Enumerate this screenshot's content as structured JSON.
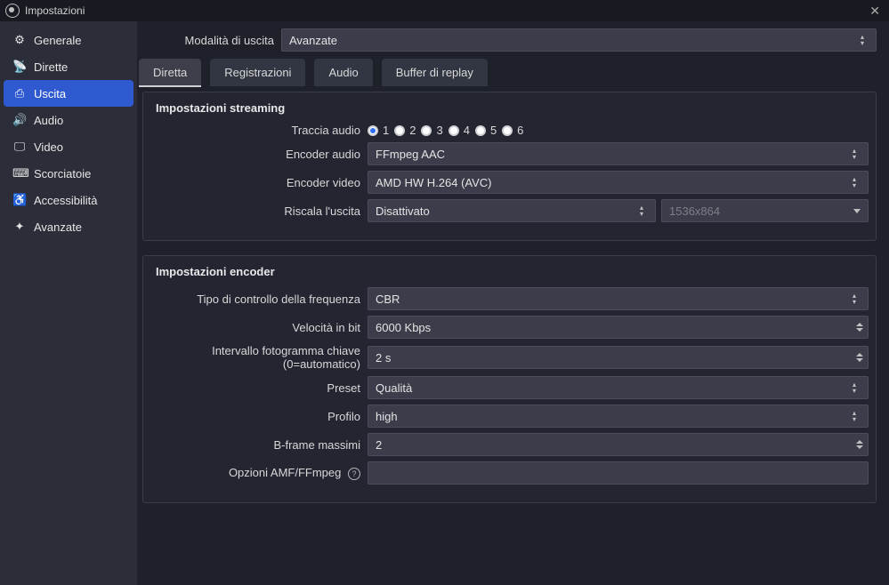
{
  "window": {
    "title": "Impostazioni"
  },
  "sidebar": {
    "items": [
      {
        "label": "Generale"
      },
      {
        "label": "Dirette"
      },
      {
        "label": "Uscita"
      },
      {
        "label": "Audio"
      },
      {
        "label": "Video"
      },
      {
        "label": "Scorciatoie"
      },
      {
        "label": "Accessibilità"
      },
      {
        "label": "Avanzate"
      }
    ]
  },
  "output_mode": {
    "label": "Modalità di uscita",
    "value": "Avanzate"
  },
  "tabs": {
    "diretta": "Diretta",
    "registrazioni": "Registrazioni",
    "audio": "Audio",
    "replay": "Buffer di replay"
  },
  "streaming": {
    "title": "Impostazioni streaming",
    "audiotrack_label": "Traccia audio",
    "tracks": [
      "1",
      "2",
      "3",
      "4",
      "5",
      "6"
    ],
    "enc_audio_label": "Encoder audio",
    "enc_audio_value": "FFmpeg AAC",
    "enc_video_label": "Encoder video",
    "enc_video_value": "AMD HW H.264 (AVC)",
    "rescale_label": "Riscala l'uscita",
    "rescale_value": "Disattivato",
    "rescale_res": "1536x864"
  },
  "encoder": {
    "title": "Impostazioni encoder",
    "rate_control_label": "Tipo di controllo della frequenza",
    "rate_control_value": "CBR",
    "bitrate_label": "Velocità in bit",
    "bitrate_value": "6000 Kbps",
    "keyframe_label": "Intervallo fotogramma chiave (0=automatico)",
    "keyframe_value": "2 s",
    "preset_label": "Preset",
    "preset_value": "Qualità",
    "profile_label": "Profilo",
    "profile_value": "high",
    "bframes_label": "B-frame massimi",
    "bframes_value": "2",
    "amf_label": "Opzioni AMF/FFmpeg",
    "amf_value": ""
  }
}
